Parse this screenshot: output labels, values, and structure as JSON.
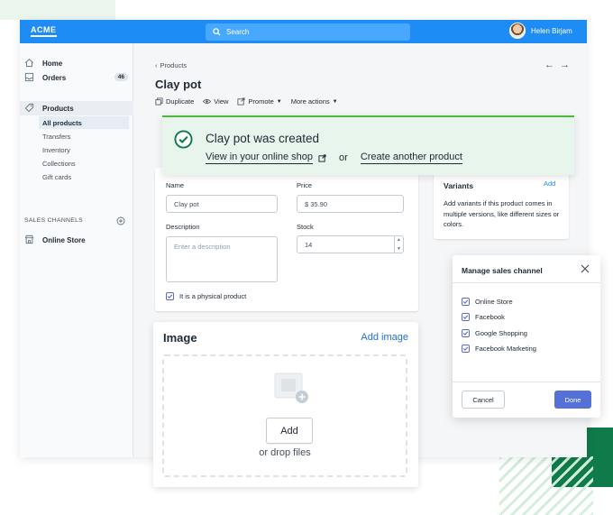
{
  "topbar": {
    "logo": "ACME",
    "search_placeholder": "Search",
    "user_name": "Helen Birjam"
  },
  "sidebar": {
    "home": "Home",
    "orders": "Orders",
    "orders_count": "46",
    "products": "Products",
    "sub_items": [
      "All products",
      "Transfers",
      "Inventory",
      "Collections",
      "Gift cards"
    ],
    "channels_heading": "SALES CHANNELS",
    "online_store": "Online Store"
  },
  "main": {
    "back_label": "Products",
    "title": "Clay pot",
    "actions": {
      "duplicate": "Duplicate",
      "view": "View",
      "promote": "Promote",
      "more": "More actions"
    }
  },
  "toast": {
    "title": "Clay pot was created",
    "view_link": "View in your online shop",
    "or": "or",
    "create_link": "Create another product"
  },
  "form": {
    "name_label": "Name",
    "name_value": "Clay pot",
    "price_label": "Price",
    "price_value": "$ 35.90",
    "description_label": "Description",
    "description_placeholder": "Enter a description",
    "stock_label": "Stock",
    "stock_value": "14",
    "physical_label": "It is a physical product"
  },
  "variants": {
    "title": "Variants",
    "add": "Add",
    "description": "Add variants if this product comes in multiple versions, like different sizes or colors."
  },
  "image_card": {
    "title": "Image",
    "add_link": "Add image",
    "add_button": "Add",
    "drop_text": "or drop files"
  },
  "modal": {
    "title": "Manage sales channel",
    "channels": [
      "Online Store",
      "Facebook",
      "Google Shopping",
      "Facebook Marketing"
    ],
    "cancel": "Cancel",
    "done": "Done"
  },
  "colors": {
    "topbar": "#1e8cf5",
    "success": "#50b83c",
    "primary_button": "#5570d6",
    "deco_green": "#0f7a4a"
  }
}
